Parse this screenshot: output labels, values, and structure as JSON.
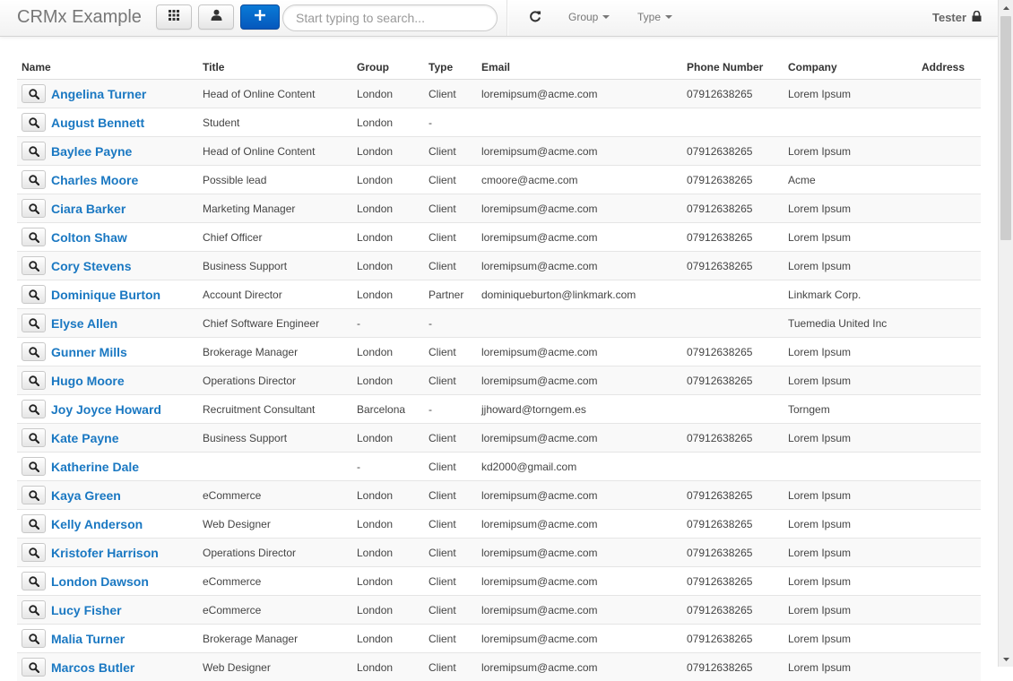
{
  "navbar": {
    "brand": "CRMx Example",
    "search_placeholder": "Start typing to search...",
    "group_label": "Group",
    "type_label": "Type",
    "user_label": "Tester"
  },
  "table": {
    "columns": [
      "Name",
      "Title",
      "Group",
      "Type",
      "Email",
      "Phone Number",
      "Company",
      "Address"
    ],
    "rows": [
      {
        "name": "Angelina Turner",
        "title": "Head of Online Content",
        "group": "London",
        "type": "Client",
        "email": "loremipsum@acme.com",
        "phone": "07912638265",
        "company": "Lorem Ipsum",
        "address": ""
      },
      {
        "name": "August Bennett",
        "title": "Student",
        "group": "London",
        "type": "-",
        "email": "",
        "phone": "",
        "company": "",
        "address": ""
      },
      {
        "name": "Baylee Payne",
        "title": "Head of Online Content",
        "group": "London",
        "type": "Client",
        "email": "loremipsum@acme.com",
        "phone": "07912638265",
        "company": "Lorem Ipsum",
        "address": ""
      },
      {
        "name": "Charles Moore",
        "title": "Possible lead",
        "group": "London",
        "type": "Client",
        "email": "cmoore@acme.com",
        "phone": "07912638265",
        "company": "Acme",
        "address": ""
      },
      {
        "name": "Ciara Barker",
        "title": "Marketing Manager",
        "group": "London",
        "type": "Client",
        "email": "loremipsum@acme.com",
        "phone": "07912638265",
        "company": "Lorem Ipsum",
        "address": ""
      },
      {
        "name": "Colton Shaw",
        "title": "Chief Officer",
        "group": "London",
        "type": "Client",
        "email": "loremipsum@acme.com",
        "phone": "07912638265",
        "company": "Lorem Ipsum",
        "address": ""
      },
      {
        "name": "Cory Stevens",
        "title": "Business Support",
        "group": "London",
        "type": "Client",
        "email": "loremipsum@acme.com",
        "phone": "07912638265",
        "company": "Lorem Ipsum",
        "address": ""
      },
      {
        "name": "Dominique Burton",
        "title": "Account Director",
        "group": "London",
        "type": "Partner",
        "email": "dominiqueburton@linkmark.com",
        "phone": "",
        "company": "Linkmark Corp.",
        "address": ""
      },
      {
        "name": "Elyse Allen",
        "title": "Chief Software Engineer",
        "group": "-",
        "type": "-",
        "email": "",
        "phone": "",
        "company": "Tuemedia United Inc",
        "address": ""
      },
      {
        "name": "Gunner Mills",
        "title": "Brokerage Manager",
        "group": "London",
        "type": "Client",
        "email": "loremipsum@acme.com",
        "phone": "07912638265",
        "company": "Lorem Ipsum",
        "address": ""
      },
      {
        "name": "Hugo Moore",
        "title": "Operations Director",
        "group": "London",
        "type": "Client",
        "email": "loremipsum@acme.com",
        "phone": "07912638265",
        "company": "Lorem Ipsum",
        "address": ""
      },
      {
        "name": "Joy Joyce Howard",
        "title": "Recruitment Consultant",
        "group": "Barcelona",
        "type": "-",
        "email": "jjhoward@torngem.es",
        "phone": "",
        "company": "Torngem",
        "address": ""
      },
      {
        "name": "Kate Payne",
        "title": "Business Support",
        "group": "London",
        "type": "Client",
        "email": "loremipsum@acme.com",
        "phone": "07912638265",
        "company": "Lorem Ipsum",
        "address": ""
      },
      {
        "name": "Katherine Dale",
        "title": "",
        "group": "-",
        "type": "Client",
        "email": "kd2000@gmail.com",
        "phone": "",
        "company": "",
        "address": ""
      },
      {
        "name": "Kaya Green",
        "title": "eCommerce",
        "group": "London",
        "type": "Client",
        "email": "loremipsum@acme.com",
        "phone": "07912638265",
        "company": "Lorem Ipsum",
        "address": ""
      },
      {
        "name": "Kelly Anderson",
        "title": "Web Designer",
        "group": "London",
        "type": "Client",
        "email": "loremipsum@acme.com",
        "phone": "07912638265",
        "company": "Lorem Ipsum",
        "address": ""
      },
      {
        "name": "Kristofer Harrison",
        "title": "Operations Director",
        "group": "London",
        "type": "Client",
        "email": "loremipsum@acme.com",
        "phone": "07912638265",
        "company": "Lorem Ipsum",
        "address": ""
      },
      {
        "name": "London Dawson",
        "title": "eCommerce",
        "group": "London",
        "type": "Client",
        "email": "loremipsum@acme.com",
        "phone": "07912638265",
        "company": "Lorem Ipsum",
        "address": ""
      },
      {
        "name": "Lucy Fisher",
        "title": "eCommerce",
        "group": "London",
        "type": "Client",
        "email": "loremipsum@acme.com",
        "phone": "07912638265",
        "company": "Lorem Ipsum",
        "address": ""
      },
      {
        "name": "Malia Turner",
        "title": "Brokerage Manager",
        "group": "London",
        "type": "Client",
        "email": "loremipsum@acme.com",
        "phone": "07912638265",
        "company": "Lorem Ipsum",
        "address": ""
      },
      {
        "name": "Marcos Butler",
        "title": "Web Designer",
        "group": "London",
        "type": "Client",
        "email": "loremipsum@acme.com",
        "phone": "07912638265",
        "company": "Lorem Ipsum",
        "address": ""
      }
    ]
  }
}
